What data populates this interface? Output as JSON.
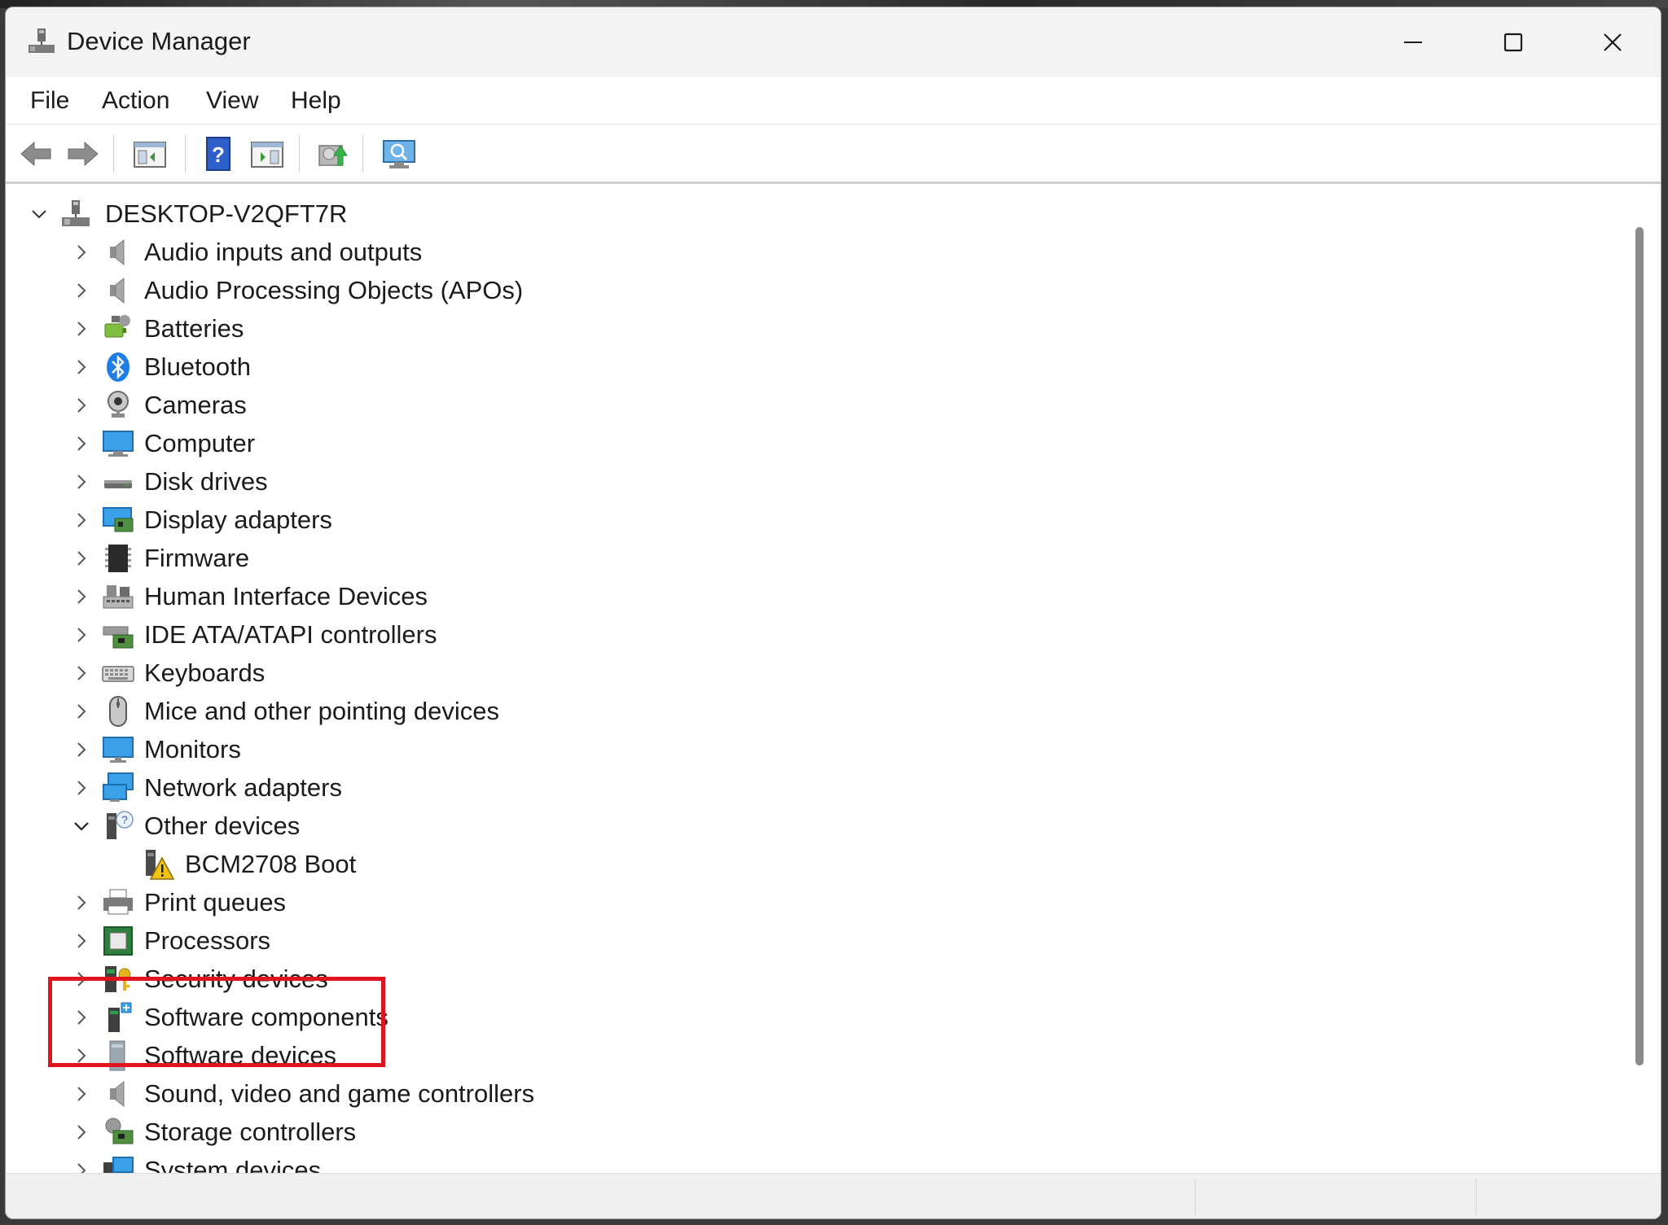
{
  "window": {
    "title": "Device Manager"
  },
  "menu": [
    "File",
    "Action",
    "View",
    "Help"
  ],
  "toolbar_icons": [
    "back-arrow-icon",
    "forward-arrow-icon",
    "show-hide-console-tree-icon",
    "help-icon",
    "properties-pane-icon",
    "update-driver-icon",
    "scan-hardware-icon"
  ],
  "tree": {
    "root": "DESKTOP-V2QFT7R",
    "categories": [
      {
        "label": "Audio inputs and outputs",
        "icon": "speaker-icon"
      },
      {
        "label": "Audio Processing Objects (APOs)",
        "icon": "speaker-icon"
      },
      {
        "label": "Batteries",
        "icon": "battery-icon"
      },
      {
        "label": "Bluetooth",
        "icon": "bluetooth-icon"
      },
      {
        "label": "Cameras",
        "icon": "camera-icon"
      },
      {
        "label": "Computer",
        "icon": "computer-icon"
      },
      {
        "label": "Disk drives",
        "icon": "disk-drive-icon"
      },
      {
        "label": "Display adapters",
        "icon": "display-adapter-icon"
      },
      {
        "label": "Firmware",
        "icon": "firmware-icon"
      },
      {
        "label": "Human Interface Devices",
        "icon": "hid-icon"
      },
      {
        "label": "IDE ATA/ATAPI controllers",
        "icon": "ide-controller-icon"
      },
      {
        "label": "Keyboards",
        "icon": "keyboard-icon"
      },
      {
        "label": "Mice and other pointing devices",
        "icon": "mouse-icon"
      },
      {
        "label": "Monitors",
        "icon": "monitor-icon"
      },
      {
        "label": "Network adapters",
        "icon": "network-adapter-icon"
      },
      {
        "label": "Other devices",
        "icon": "unknown-device-icon",
        "expanded": true
      },
      {
        "label": "Print queues",
        "icon": "printer-icon"
      },
      {
        "label": "Processors",
        "icon": "processor-icon"
      },
      {
        "label": "Security devices",
        "icon": "security-device-icon"
      },
      {
        "label": "Software components",
        "icon": "software-component-icon"
      },
      {
        "label": "Software devices",
        "icon": "software-device-icon"
      },
      {
        "label": "Sound, video and game controllers",
        "icon": "speaker-icon"
      },
      {
        "label": "Storage controllers",
        "icon": "storage-controller-icon"
      },
      {
        "label": "System devices",
        "icon": "system-devices-icon"
      }
    ],
    "other_devices_children": [
      {
        "label": "BCM2708 Boot",
        "icon": "warning-device-icon"
      }
    ]
  },
  "colors": {
    "highlight": "#e0141e",
    "titlebar": "#f3f3f3"
  }
}
